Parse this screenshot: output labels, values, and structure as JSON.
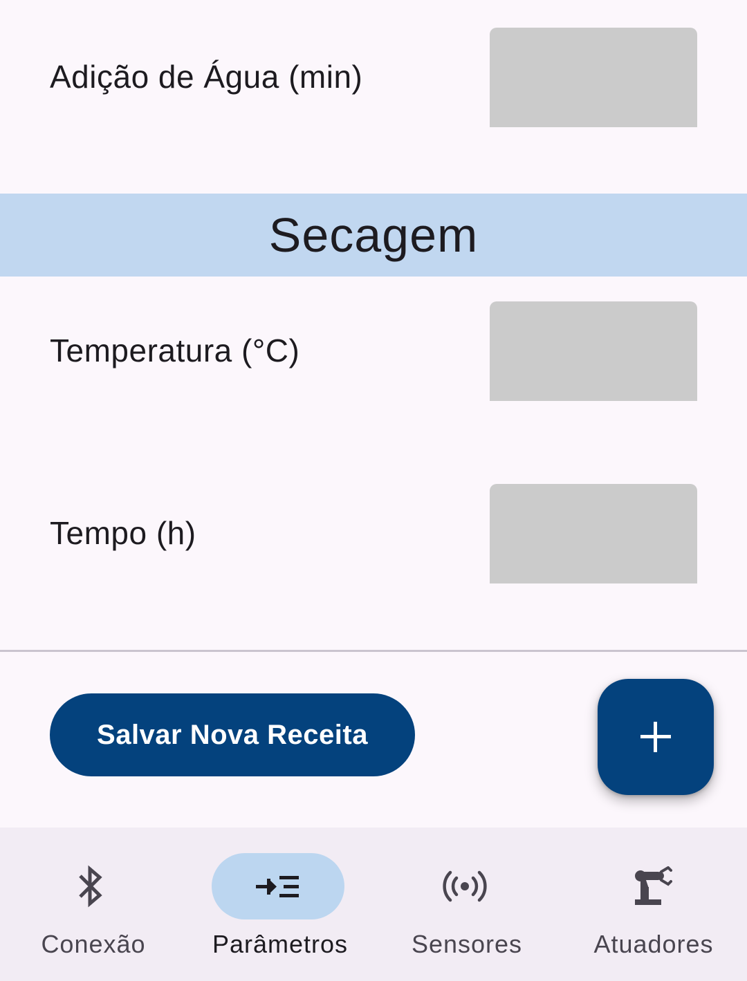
{
  "parameters": {
    "agua": {
      "label": "Adição de Água (min)",
      "value": ""
    },
    "section_title": "Secagem",
    "temperatura": {
      "label": "Temperatura (°C)",
      "value": ""
    },
    "tempo": {
      "label": "Tempo (h)",
      "value": ""
    }
  },
  "actions": {
    "save_label": "Salvar Nova Receita",
    "fab_icon": "plus-icon"
  },
  "nav": {
    "items": [
      {
        "label": "Conexão",
        "icon": "bluetooth-icon",
        "active": false
      },
      {
        "label": "Parâmetros",
        "icon": "parameters-icon",
        "active": true
      },
      {
        "label": "Sensores",
        "icon": "sensors-icon",
        "active": false
      },
      {
        "label": "Atuadores",
        "icon": "robot-arm-icon",
        "active": false
      }
    ]
  },
  "colors": {
    "background": "#fcf7fc",
    "section_band": "#c1d7f0",
    "primary": "#04427d",
    "input_fill": "#cbcbcb",
    "nav_background": "#f2ecf4",
    "nav_active_pill": "#bcd6f0"
  }
}
